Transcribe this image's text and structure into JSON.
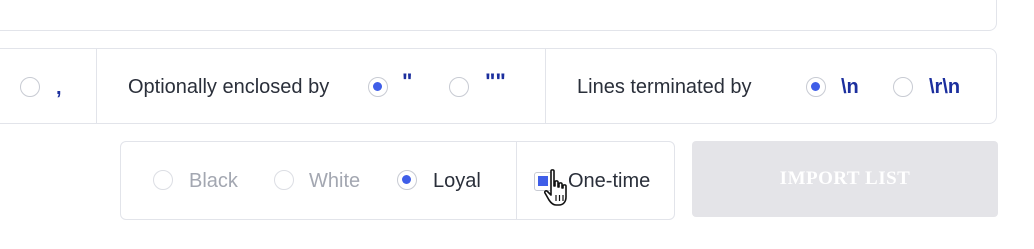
{
  "delimiter": {
    "comma_symbol": ","
  },
  "enclosed": {
    "label": "Optionally enclosed by",
    "option_double_quote": "\"",
    "option_double_double_quote": "\"\""
  },
  "terminated": {
    "label": "Lines terminated by",
    "option_lf": "\\n",
    "option_crlf": "\\r\\n"
  },
  "list_type": {
    "black": "Black",
    "white": "White",
    "loyal": "Loyal",
    "one_time": "One-time"
  },
  "import_button": "IMPORT LIST",
  "colors": {
    "accent": "#3f5ee8",
    "symbol": "#1c2f9e",
    "button_bg": "#e4e4e8",
    "border": "#e2e4ea"
  },
  "icons": {
    "cursor": "hand-pointer-icon"
  }
}
